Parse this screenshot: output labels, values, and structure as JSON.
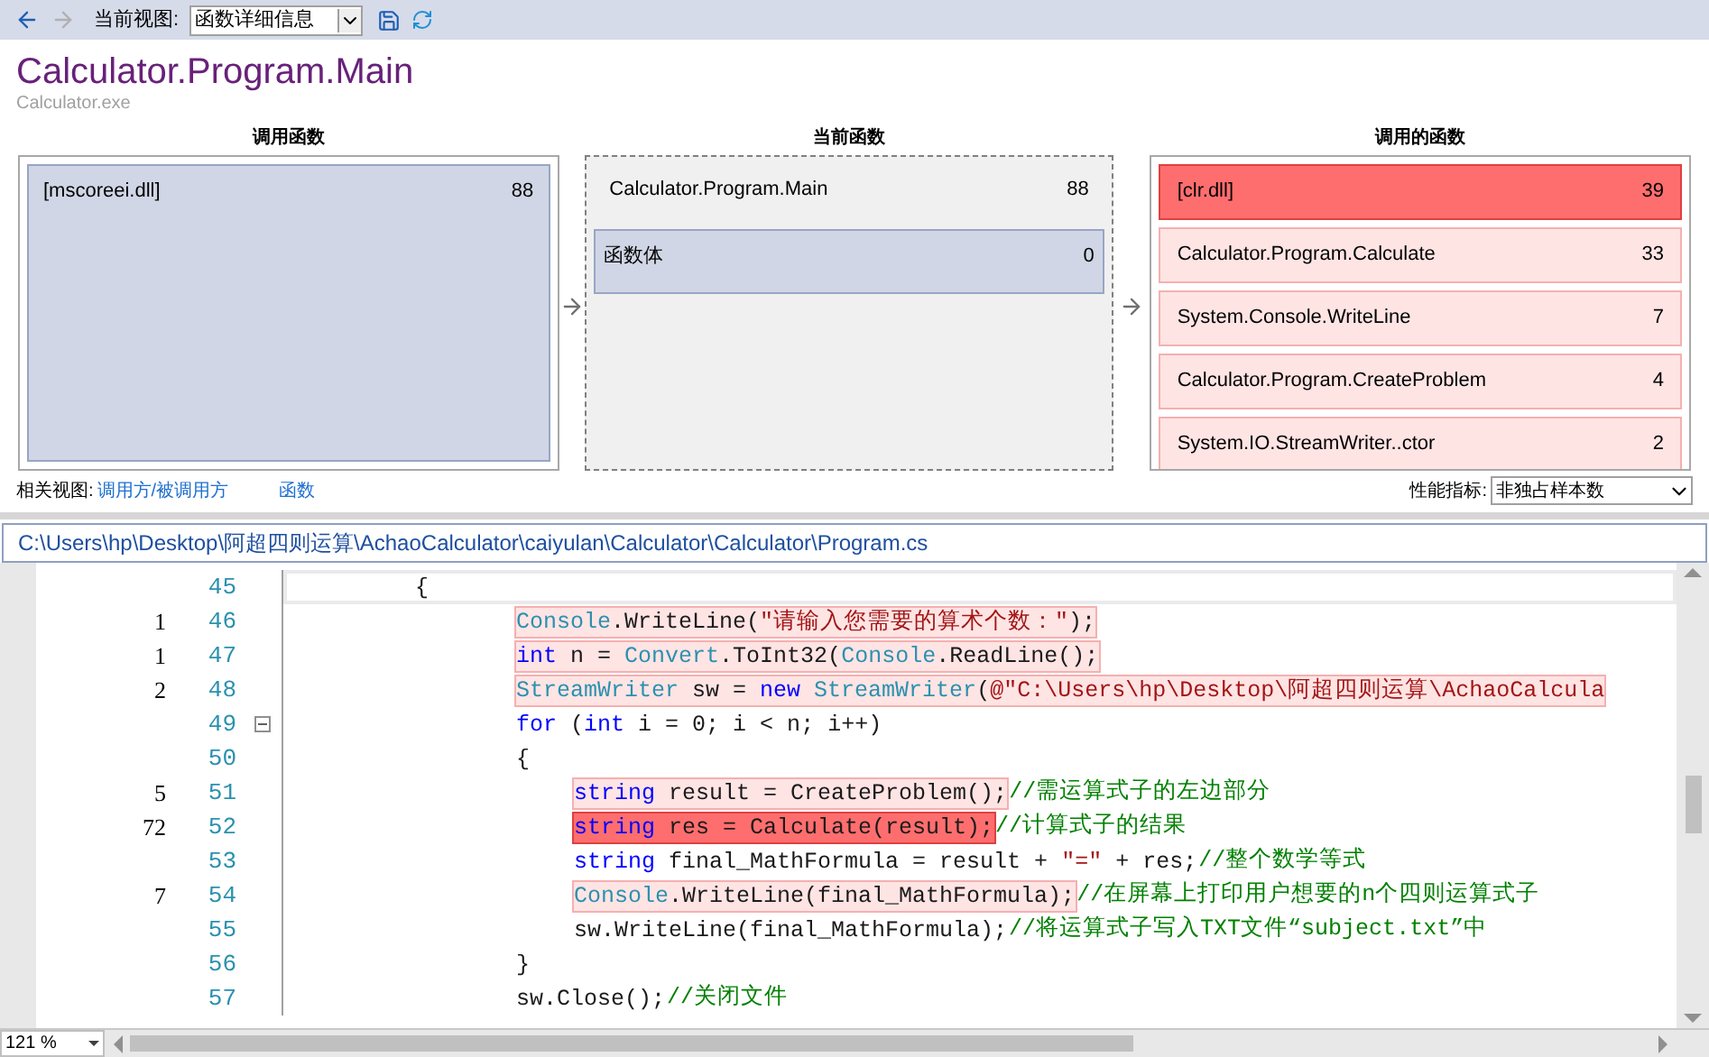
{
  "toolbar": {
    "back": {
      "disabled": false
    },
    "forward": {
      "disabled": true
    },
    "view_label": "当前视图:",
    "view_value": "函数详细信息"
  },
  "header": {
    "title": "Calculator.Program.Main",
    "subtitle": "Calculator.exe"
  },
  "callers": {
    "heading": "调用函数",
    "items": [
      {
        "name": "[mscoreei.dll]",
        "value": "88"
      }
    ]
  },
  "current": {
    "heading": "当前函数",
    "name": "Calculator.Program.Main",
    "value": "88",
    "items": [
      {
        "name": "函数体",
        "value": "0"
      }
    ]
  },
  "callees": {
    "heading": "调用的函数",
    "items": [
      {
        "name": "[clr.dll]",
        "value": "39",
        "color": "#ff6e6e"
      },
      {
        "name": "Calculator.Program.Calculate",
        "value": "33",
        "color": "#ffe4e4"
      },
      {
        "name": "System.Console.WriteLine",
        "value": "7",
        "color": "#ffe4e4"
      },
      {
        "name": "Calculator.Program.CreateProblem",
        "value": "4",
        "color": "#ffe4e4"
      },
      {
        "name": "System.IO.StreamWriter..ctor",
        "value": "2",
        "color": "#ffe4e4"
      }
    ]
  },
  "related": {
    "label": "相关视图:",
    "links": [
      "调用方/被调用方",
      "函数"
    ],
    "metric_label": "性能指标:",
    "metric_value": "非独占样本数"
  },
  "file_path": "C:\\Users\\hp\\Desktop\\阿超四则运算\\AchaoCalculator\\caiyulan\\Calculator\\Calculator\\Program.cs",
  "code": {
    "lines": [
      {
        "num": "45",
        "current": true,
        "foldable": false,
        "tokens": [
          {
            "kind": "plain",
            "text": "{"
          }
        ],
        "children": [
          {
            "num": "46",
            "count": "1",
            "current": false,
            "foldable": false,
            "color": "#ffe4e4",
            "tokens": [
              {
                "kind": "type",
                "text": "Console"
              },
              {
                "kind": "plain",
                "text": ".WriteLine("
              },
              {
                "kind": "str",
                "text": "\"请输入您需要的算术个数：\""
              },
              {
                "kind": "plain",
                "text": ");"
              }
            ]
          },
          {
            "num": "47",
            "count": "1",
            "current": false,
            "foldable": false,
            "color": "#ffe4e4",
            "tokens": [
              {
                "kind": "kw",
                "text": "int"
              },
              {
                "kind": "plain",
                "text": " n = "
              },
              {
                "kind": "type",
                "text": "Convert"
              },
              {
                "kind": "plain",
                "text": ".ToInt32("
              },
              {
                "kind": "type",
                "text": "Console"
              },
              {
                "kind": "plain",
                "text": ".ReadLine();"
              }
            ]
          },
          {
            "num": "48",
            "count": "2",
            "current": false,
            "foldable": false,
            "color": "#ffe4e4",
            "tokens": [
              {
                "kind": "type",
                "text": "StreamWriter"
              },
              {
                "kind": "plain",
                "text": " sw = "
              },
              {
                "kind": "kw",
                "text": "new"
              },
              {
                "kind": "type",
                "text": " StreamWriter"
              },
              {
                "kind": "plain",
                "text": "("
              },
              {
                "kind": "str",
                "text": "@\"C:\\Users\\hp\\Desktop\\阿超四则运算\\AchaoCalcula"
              }
            ]
          },
          {
            "num": "49",
            "current": false,
            "foldable": true,
            "tokens": [
              {
                "kind": "kw",
                "text": "for"
              },
              {
                "kind": "plain",
                "text": " ("
              },
              {
                "kind": "kw",
                "text": "int"
              },
              {
                "kind": "plain",
                "text": " i = 0; i < n; i++)"
              }
            ]
          },
          {
            "num": "50",
            "current": false,
            "foldable": false,
            "tokens": [
              {
                "kind": "plain",
                "text": "{"
              }
            ],
            "children": [
              {
                "num": "51",
                "count": "5",
                "current": false,
                "foldable": false,
                "color": "#ffe4e4",
                "tokens": [
                  {
                    "kind": "kw",
                    "text": "string"
                  },
                  {
                    "kind": "plain",
                    "text": " result = CreateProblem();"
                  }
                ],
                "comment": "//需运算式子的左边部分"
              },
              {
                "num": "52",
                "count": "72",
                "current": false,
                "foldable": false,
                "color": "#ff6e6e",
                "tokens": [
                  {
                    "kind": "kw",
                    "text": "string"
                  },
                  {
                    "kind": "plain",
                    "text": " res = Calculate(result);"
                  }
                ],
                "comment": "//计算式子的结果"
              },
              {
                "num": "53",
                "current": false,
                "foldable": false,
                "tokens": [
                  {
                    "kind": "kw",
                    "text": "string"
                  },
                  {
                    "kind": "plain",
                    "text": " final_MathFormula = result + "
                  },
                  {
                    "kind": "str",
                    "text": "\"=\""
                  },
                  {
                    "kind": "plain",
                    "text": " + res;"
                  }
                ],
                "comment": "//整个数学等式"
              },
              {
                "num": "54",
                "count": "7",
                "current": false,
                "foldable": false,
                "color": "#ffe4e4",
                "tokens": [
                  {
                    "kind": "type",
                    "text": "Console"
                  },
                  {
                    "kind": "plain",
                    "text": ".WriteLine(final_MathFormula);"
                  }
                ],
                "comment": "//在屏幕上打印用户想要的n个四则运算式子"
              },
              {
                "num": "55",
                "current": false,
                "foldable": false,
                "tokens": [
                  {
                    "kind": "plain",
                    "text": "sw.WriteLine(final_MathFormula);"
                  }
                ],
                "comment": "//将运算式子写入TXT文件“subject.txt”中"
              }
            ]
          },
          {
            "num": "56",
            "current": false,
            "foldable": false,
            "tokens": [
              {
                "kind": "plain",
                "text": "}"
              }
            ]
          },
          {
            "num": "57",
            "current": false,
            "foldable": false,
            "tokens": [
              {
                "kind": "plain",
                "text": "sw.Close();"
              }
            ],
            "comment": "//关闭文件"
          }
        ]
      }
    ]
  },
  "zoom": "121 %"
}
